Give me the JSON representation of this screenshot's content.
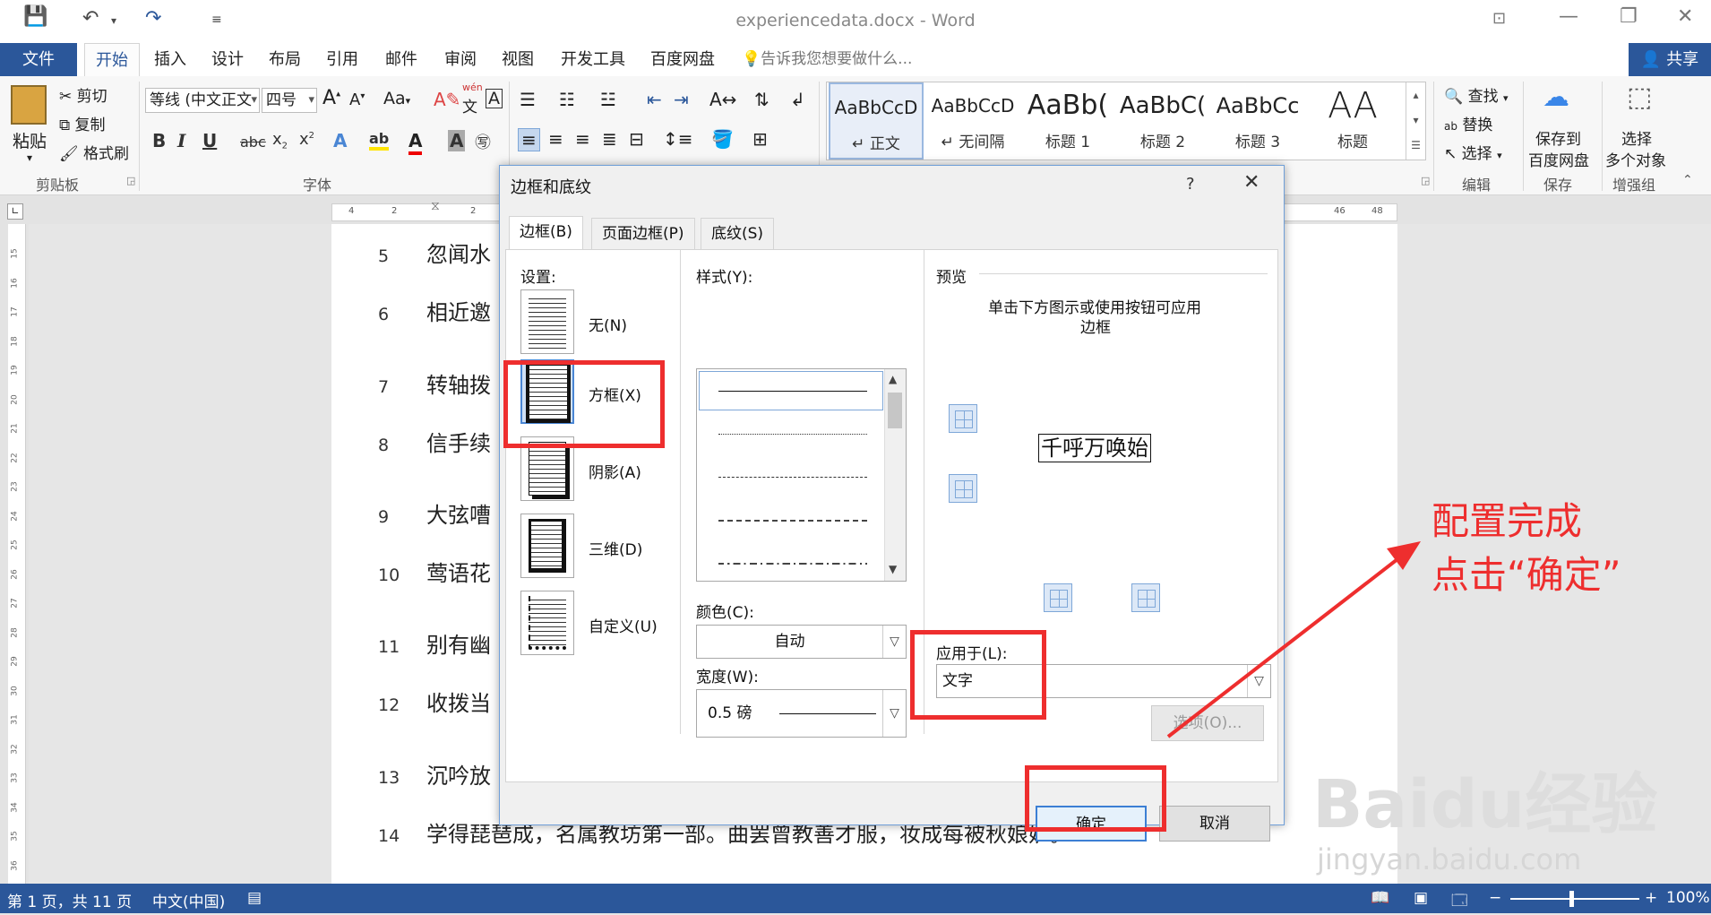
{
  "window": {
    "title": "experiencedata.docx - Word",
    "share_label": "共享"
  },
  "tabs": [
    "文件",
    "开始",
    "插入",
    "设计",
    "布局",
    "引用",
    "邮件",
    "审阅",
    "视图",
    "开发工具",
    "百度网盘"
  ],
  "tell_me": "告诉我您想要做什么...",
  "ribbon": {
    "clipboard": {
      "paste": "粘贴",
      "cut": "剪切",
      "copy": "复制",
      "format_painter": "格式刷",
      "group": "剪贴板"
    },
    "font": {
      "font_name": "等线 (中文正文",
      "font_size": "四号",
      "case_btn": "Aa",
      "group": "字体",
      "phonetic_top": "wén",
      "phonetic_bottom": "文",
      "border_char": "A"
    },
    "paragraph": {
      "group": "段落"
    },
    "styles": [
      {
        "preview": "AaBbCcD",
        "name": "↵ 正文"
      },
      {
        "preview": "AaBbCcD",
        "name": "↵ 无间隔"
      },
      {
        "preview": "AaBb(",
        "name": "标题 1"
      },
      {
        "preview": "AaBbC(",
        "name": "标题 2"
      },
      {
        "preview": "AaBbCc",
        "name": "标题 3"
      },
      {
        "preview": "AA",
        "name": "标题"
      }
    ],
    "editing": {
      "find": "查找",
      "replace": "替换",
      "select": "选择",
      "group": "编辑"
    },
    "save": {
      "label1": "保存到",
      "label2": "百度网盘",
      "group": "保存"
    },
    "enhance": {
      "label1": "选择",
      "label2": "多个对象",
      "group": "增强组"
    }
  },
  "ruler": {
    "marks": [
      "4",
      "2",
      "2",
      "46",
      "48"
    ]
  },
  "document": {
    "lines": [
      {
        "num": "5",
        "text": "忽闻水"
      },
      {
        "num": "6",
        "text": "相近邀"
      },
      {
        "num": "7",
        "text": "转轴拨"
      },
      {
        "num": "8",
        "text": "信手续"
      },
      {
        "num": "9",
        "text": "大弦嘈"
      },
      {
        "num": "10",
        "text": "莺语花"
      },
      {
        "num": "11",
        "text": "别有幽"
      },
      {
        "num": "12",
        "text": "收拨当"
      },
      {
        "num": "13",
        "text": "沉吟放"
      },
      {
        "num": "14",
        "text": "学得琵琶成，名属教坊第一部。曲罢曾教善才服，妆成每被秋娘妒。↵"
      }
    ],
    "vruler_marks": [
      "15",
      "16",
      "17",
      "18",
      "19",
      "20",
      "21",
      "22",
      "23",
      "24",
      "25",
      "26",
      "27",
      "28",
      "29",
      "30",
      "31",
      "32",
      "33",
      "34",
      "35",
      "36"
    ]
  },
  "status": {
    "page": "第 1 页，共 11 页",
    "language": "中文(中国)",
    "zoom": "100%"
  },
  "dialog": {
    "title": "边框和底纹",
    "help": "?",
    "tabs": [
      "边框(B)",
      "页面边框(P)",
      "底纹(S)"
    ],
    "settings_label": "设置:",
    "settings": [
      "无(N)",
      "方框(X)",
      "阴影(A)",
      "三维(D)",
      "自定义(U)"
    ],
    "style_label": "样式(Y):",
    "color_label": "颜色(C):",
    "color_value": "自动",
    "width_label": "宽度(W):",
    "width_value": "0.5 磅",
    "preview_label": "预览",
    "preview_hint_1": "单击下方图示或使用按钮可应用",
    "preview_hint_2": "边框",
    "preview_text": "千呼万唤始",
    "apply_label": "应用于(L):",
    "apply_value": "文字",
    "options_btn": "选项(O)...",
    "ok_btn": "确定",
    "cancel_btn": "取消"
  },
  "annotation": {
    "line1": "配置完成",
    "line2": "点击“确定”"
  },
  "watermark": {
    "brand": "Baidu经验",
    "url": "jingyan.baidu.com"
  }
}
